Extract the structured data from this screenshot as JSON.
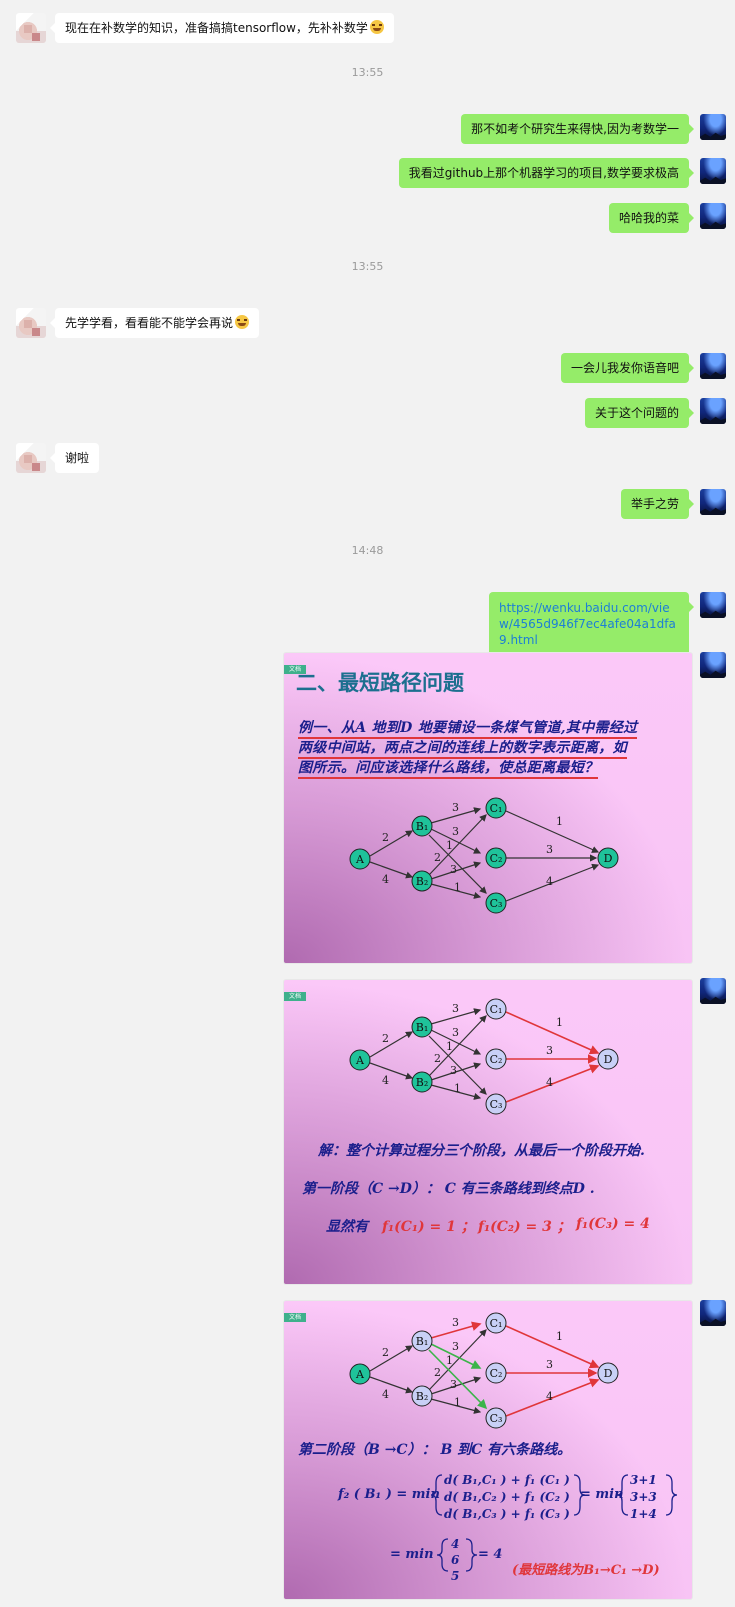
{
  "messages": {
    "m1": "现在在补数学的知识，准备搞搞tensorflow，先补补数学",
    "t1": "13:55",
    "m2": "那不如考个研究生来得快,因为考数学一",
    "m3": "我看过github上那个机器学习的项目,数学要求极高",
    "m4": "哈哈我的菜",
    "t2": "13:55",
    "m5": "先学学看，看看能不能学会再说",
    "m6": "一会儿我发你语音吧",
    "m7": "关于这个问题的",
    "m8": "谢啦",
    "m9": "举手之劳",
    "t3": "14:48",
    "m10": "https://wenku.baidu.com/view/4565d946f7ec4afe04a1dfa9.html"
  },
  "slides": {
    "tag": "文档",
    "s1": {
      "title": "二、最短路径问题",
      "problem": [
        "例一、从A 地到D 地要铺设一条煤气管道,其中需经过",
        "两级中间站，两点之间的连线上的数字表示距离，如",
        "图所示。问应该选择什么路线，使总距离最短？"
      ]
    },
    "s2": {
      "solution": "解：整个计算过程分三个阶段，从最后一个阶段开始.",
      "stage1": "第一阶段（C →D）： C 有三条路线到终点D .",
      "obvious": "显然有",
      "f1": "f₁(C₁) = 1 ；",
      "f2": "f₁(C₂) = 3 ；",
      "f3": "f₁(C₃) = 4"
    },
    "s3": {
      "stage2": "第二阶段（B →C）： B 到C 有六条路线。",
      "lhs": "f₂ ( B₁ ) = min",
      "r1": "d( B₁,C₁ ) + f₁ (C₁ )",
      "r2": "d( B₁,C₂ ) + f₁ (C₂ )",
      "r3": "d( B₁,C₃ ) + f₁ (C₃ )",
      "mid": "= min",
      "v1": "3+1",
      "v2": "3+3",
      "v3": "1+4",
      "eq2": "= min",
      "w1": "4",
      "w2": "6",
      "w3": "5",
      "res": "= 4",
      "route": "(最短路线为B₁→C₁ →D)"
    },
    "graph": {
      "nodes": [
        "A",
        "B₁",
        "B₂",
        "C₁",
        "C₂",
        "C₃",
        "D"
      ],
      "weights": [
        "2",
        "4",
        "3",
        "3",
        "1",
        "2",
        "3",
        "1",
        "1",
        "3",
        "4"
      ]
    }
  },
  "colors": {
    "green_bubble": "#95ec69",
    "link": "#1c7fd6",
    "node_green": "#1fc39a",
    "node_blue": "#c8d0f6",
    "edge_red": "#e0363a"
  }
}
